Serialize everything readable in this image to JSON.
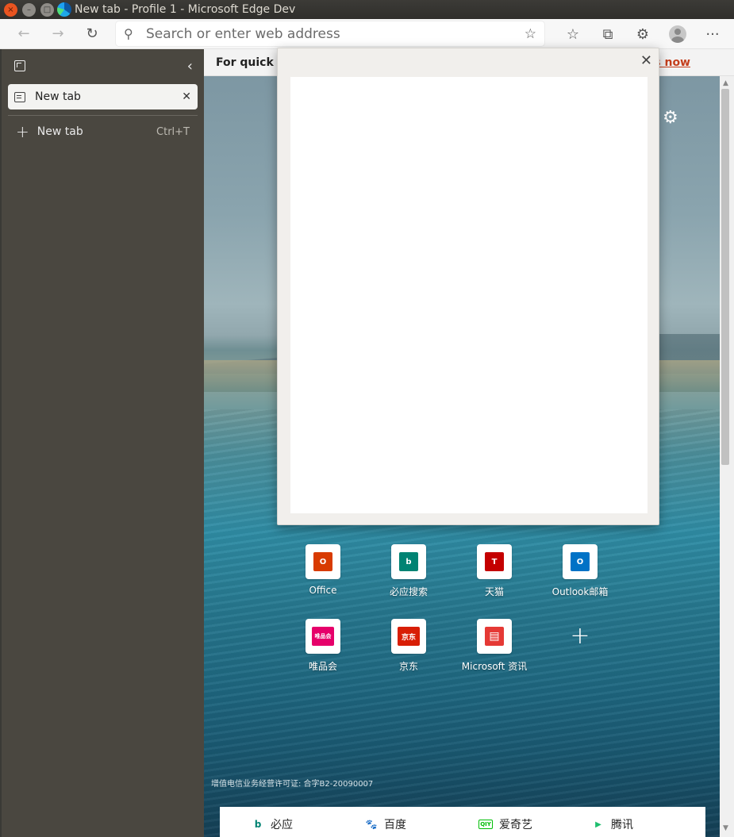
{
  "window": {
    "title": "New tab - Profile 1 - Microsoft Edge Dev",
    "close": "×",
    "minimize": "–",
    "maximize": "□"
  },
  "toolbar": {
    "back_icon": "←",
    "forward_icon": "→",
    "refresh_icon": "↻",
    "search_icon": "⚲",
    "address_placeholder": "Search or enter web address",
    "add_favorite_icon": "☆",
    "favorites_icon": "☆",
    "collections_icon": "⧉",
    "extensions_icon": "⚙",
    "more_icon": "···"
  },
  "sidebar": {
    "collapse_icon": "‹",
    "tabs": [
      {
        "title": "New tab",
        "close": "✕"
      }
    ],
    "new_tab": {
      "label": "New tab",
      "shortcut": "Ctrl+T",
      "icon": "+"
    }
  },
  "infobar": {
    "text": "For quick ac",
    "link": "s now"
  },
  "newtab": {
    "settings_icon": "⚙",
    "tiles": [
      {
        "label": "Office",
        "glyph": "O",
        "color": "#d83b01"
      },
      {
        "label": "必应搜索",
        "glyph": "b",
        "color": "#008373"
      },
      {
        "label": "天猫",
        "glyph": "T",
        "color": "#c40000"
      },
      {
        "label": "Outlook邮箱",
        "glyph": "O",
        "color": "#0072c6"
      },
      {
        "label": "唯品会",
        "glyph": "唯品会",
        "color": "#e6006a"
      },
      {
        "label": "京东",
        "glyph": "京东",
        "color": "#d81e06"
      },
      {
        "label": "Microsoft 资讯",
        "glyph": "▤",
        "color": "#e53935"
      }
    ],
    "add_icon": "+",
    "license": "增值电信业务经营许可证: 合字B2-20090007",
    "bottom_links": [
      {
        "label": "必应",
        "icon": "b",
        "color": "#008373"
      },
      {
        "label": "百度",
        "icon": "🐾",
        "color": "#2932e1"
      },
      {
        "label": "爱奇艺",
        "icon": "QIY",
        "color": "#00be06"
      },
      {
        "label": "腾讯",
        "icon": "▶",
        "color": "#1ebe6e"
      }
    ]
  },
  "popup": {
    "close_icon": "✕"
  },
  "scrollbar": {
    "up": "▲",
    "down": "▼"
  }
}
